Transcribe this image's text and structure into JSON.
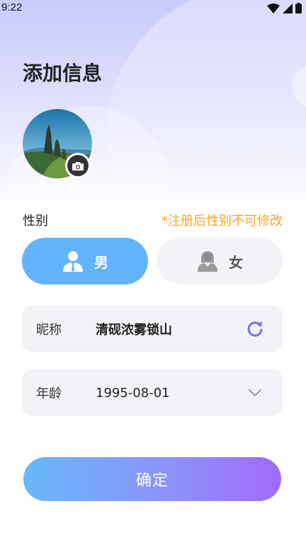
{
  "status_bar": {
    "time": "9:22"
  },
  "header": {
    "title": "添加信息"
  },
  "gender": {
    "label": "性别",
    "note": "*注册后性别不可修改",
    "male_label": "男",
    "female_label": "女",
    "selected": "男"
  },
  "nickname": {
    "label": "昵称",
    "value": "清砚浓雾锁山",
    "refresh_icon": "refresh-icon"
  },
  "age": {
    "label": "年龄",
    "value": "1995-08-01",
    "dropdown_icon": "chevron-down-icon"
  },
  "confirm": {
    "label": "确定"
  },
  "colors": {
    "accent_blue": "#62b3fb",
    "note_orange": "#f5a623",
    "refresh_purple": "#7d6cf6",
    "button_gradient_start": "#66b9fb",
    "button_gradient_end": "#a26af9"
  }
}
